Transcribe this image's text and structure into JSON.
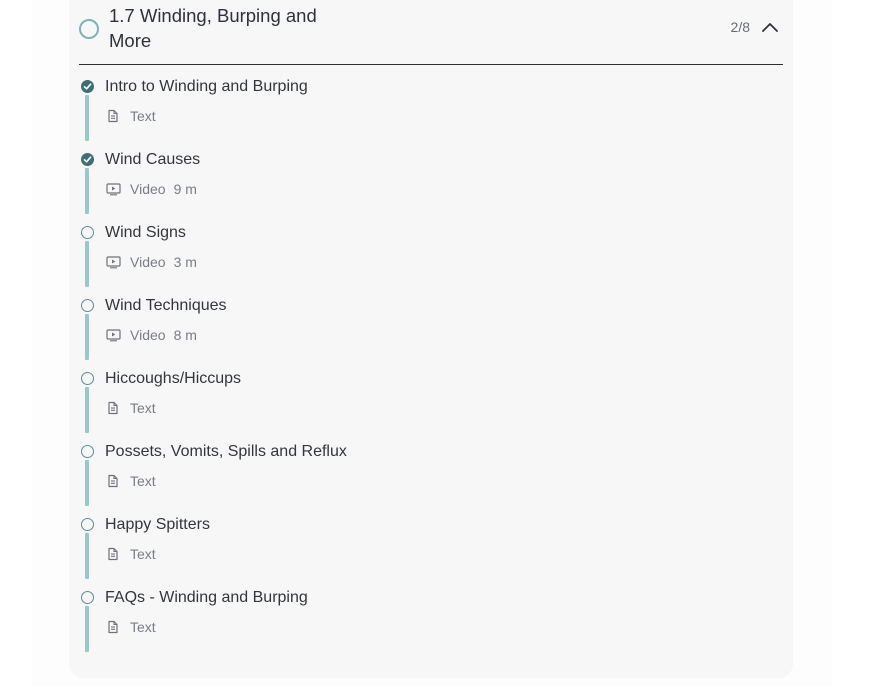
{
  "module": {
    "title": "1.7 Winding, Burping and More",
    "progress": "2/8",
    "expanded": true
  },
  "lessons": [
    {
      "title": "Intro to Winding and Burping",
      "type": "Text",
      "duration": "",
      "completed": true,
      "icon": "document-icon"
    },
    {
      "title": "Wind Causes",
      "type": "Video",
      "duration": "9 m",
      "completed": true,
      "icon": "video-icon"
    },
    {
      "title": "Wind Signs",
      "type": "Video",
      "duration": "3 m",
      "completed": false,
      "icon": "video-icon"
    },
    {
      "title": "Wind Techniques",
      "type": "Video",
      "duration": "8 m",
      "completed": false,
      "icon": "video-icon"
    },
    {
      "title": "Hiccoughs/Hiccups",
      "type": "Text",
      "duration": "",
      "completed": false,
      "icon": "document-icon"
    },
    {
      "title": "Possets, Vomits, Spills and Reflux",
      "type": "Text",
      "duration": "",
      "completed": false,
      "icon": "document-icon"
    },
    {
      "title": "Happy Spitters",
      "type": "Text",
      "duration": "",
      "completed": false,
      "icon": "document-icon"
    },
    {
      "title": "FAQs - Winding and Burping",
      "type": "Text",
      "duration": "",
      "completed": false,
      "icon": "document-icon"
    }
  ],
  "colors": {
    "accent": "#96c9c9",
    "completed": "#3f6f75",
    "text": "#33363b",
    "muted": "#7a7e83"
  }
}
